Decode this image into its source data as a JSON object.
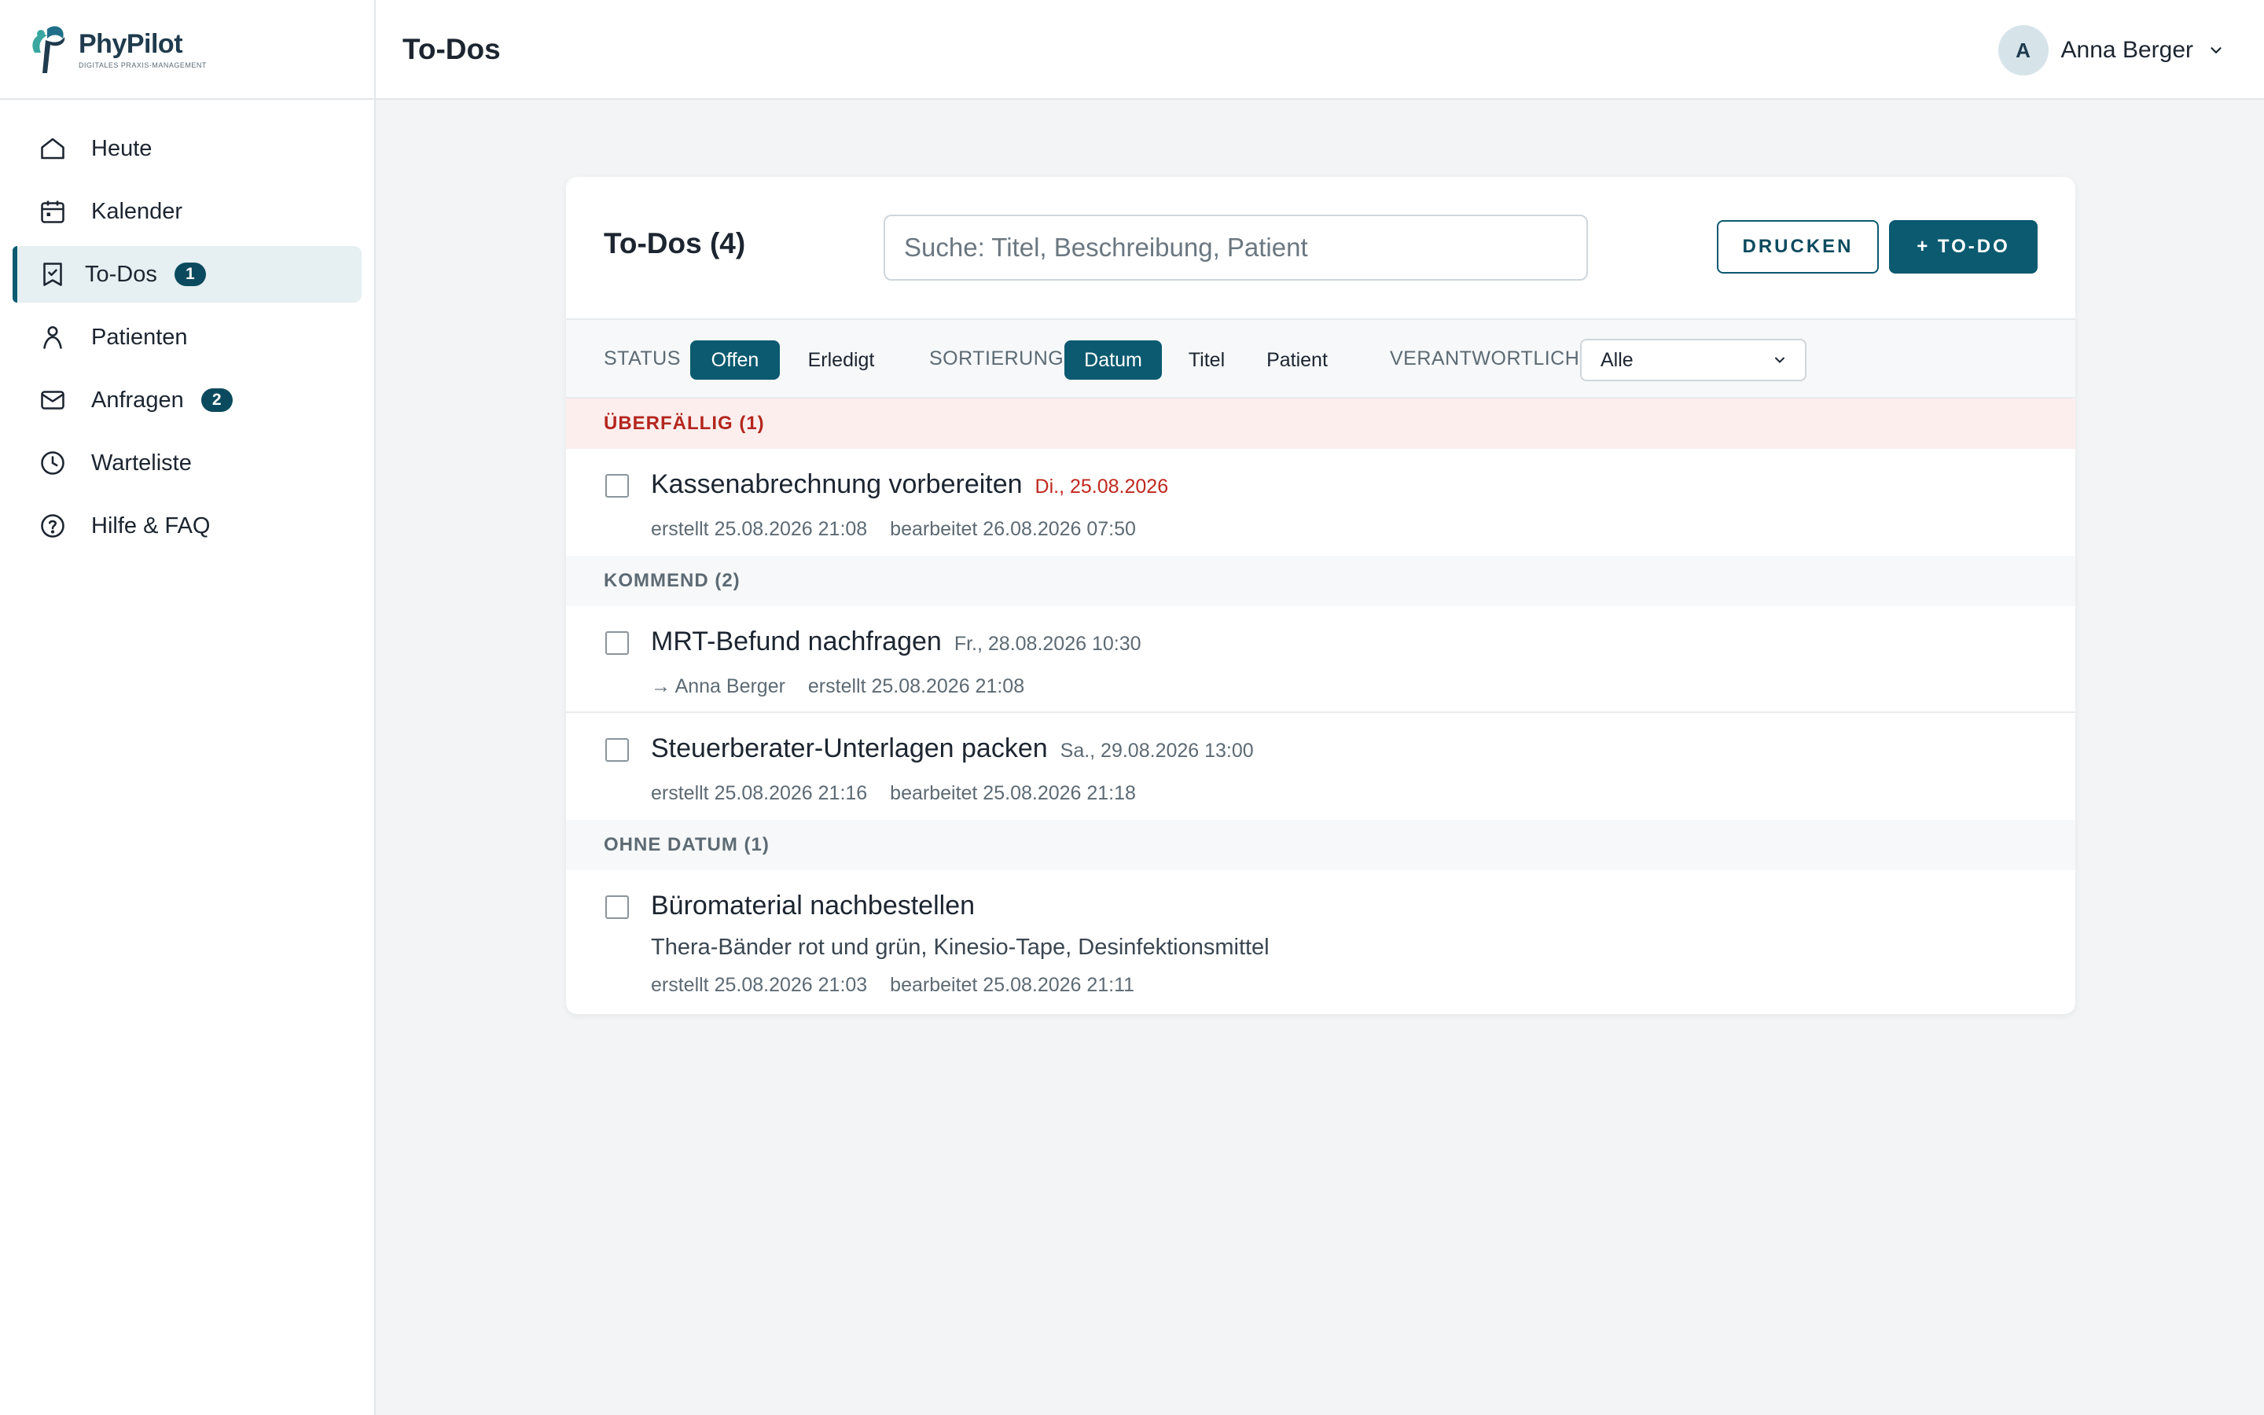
{
  "brand": {
    "name": "PhyPilot",
    "tagline": "DIGITALES PRAXIS-MANAGEMENT"
  },
  "sidebar": {
    "items": [
      {
        "label": "Heute",
        "icon": "home-icon",
        "badge": null
      },
      {
        "label": "Kalender",
        "icon": "calendar-icon",
        "badge": null
      },
      {
        "label": "To-Dos",
        "icon": "checklist-icon",
        "badge": "1",
        "active": true
      },
      {
        "label": "Patienten",
        "icon": "person-icon",
        "badge": null
      },
      {
        "label": "Anfragen",
        "icon": "mail-icon",
        "badge": "2"
      },
      {
        "label": "Warteliste",
        "icon": "clock-icon",
        "badge": null
      },
      {
        "label": "Hilfe & FAQ",
        "icon": "help-icon",
        "badge": null
      }
    ]
  },
  "header": {
    "title": "To-Dos",
    "user": {
      "initial": "A",
      "name": "Anna Berger"
    }
  },
  "card": {
    "title": "To-Dos (4)",
    "search_placeholder": "Suche: Titel, Beschreibung, Patient",
    "print_label": "DRUCKEN",
    "add_label": "+ TO-DO"
  },
  "filters": {
    "status_label": "STATUS",
    "status_options": [
      "Offen",
      "Erledigt"
    ],
    "status_selected": "Offen",
    "sort_label": "SORTIERUNG",
    "sort_options": [
      "Datum",
      "Titel",
      "Patient"
    ],
    "sort_selected": "Datum",
    "owner_label": "VERANTWORTLICH",
    "owner_value": "Alle"
  },
  "groups": {
    "overdue": {
      "label": "ÜBERFÄLLIG (1)",
      "items": [
        {
          "title": "Kassenabrechnung vorbereiten",
          "date": "Di., 25.08.2026",
          "meta": [
            "erstellt 25.08.2026 21:08",
            "bearbeitet 26.08.2026 07:50"
          ]
        }
      ]
    },
    "upcoming": {
      "label": "KOMMEND (2)",
      "items": [
        {
          "title": "MRT-Befund nachfragen",
          "date": "Fr., 28.08.2026 10:30",
          "meta": [
            "→ Anna Berger",
            "erstellt 25.08.2026 21:08"
          ]
        },
        {
          "title": "Steuerberater-Unterlagen packen",
          "date": "Sa., 29.08.2026 13:00",
          "meta": [
            "erstellt 25.08.2026 21:16",
            "bearbeitet 25.08.2026 21:18"
          ]
        }
      ]
    },
    "nodate": {
      "label": "OHNE DATUM (1)",
      "items": [
        {
          "title": "Büromaterial nachbestellen",
          "description": "Thera-Bänder rot und grün, Kinesio-Tape, Desinfektionsmittel",
          "meta": [
            "erstellt 25.08.2026 21:03",
            "bearbeitet 25.08.2026 21:11"
          ]
        }
      ]
    }
  },
  "colors": {
    "accent": "#0b5a70",
    "overdue": "#c0281e",
    "overdue_bg": "#fdeeee"
  }
}
